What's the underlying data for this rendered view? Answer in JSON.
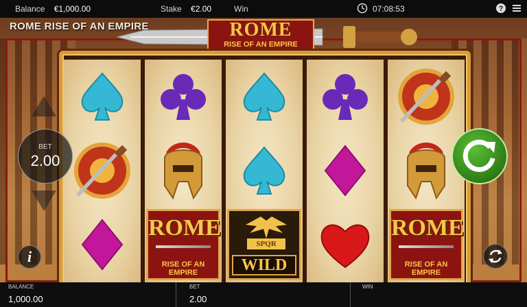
{
  "topbar": {
    "balance_label": "Balance",
    "balance_value": "€1,000.00",
    "stake_label": "Stake",
    "stake_value": "€2.00",
    "win_label": "Win",
    "time": "07:08:53"
  },
  "game": {
    "title": "ROME RISE OF AN EMPIRE",
    "logo_line1": "ROME",
    "logo_line2": "RISE OF AN EMPIRE"
  },
  "reels": [
    [
      "spade",
      "shield",
      "diamond"
    ],
    [
      "club",
      "helmet",
      "rome"
    ],
    [
      "spade",
      "spade",
      "wild"
    ],
    [
      "club",
      "diamond",
      "heart"
    ],
    [
      "shield",
      "helmet",
      "rome"
    ]
  ],
  "symbols": {
    "rome_line1": "ROME",
    "rome_line2": "RISE OF AN EMPIRE",
    "wild_badge": "SPQR",
    "wild_text": "WILD"
  },
  "controls": {
    "bet_label": "BET",
    "bet_value": "2.00",
    "info_label": "i"
  },
  "bottombar": {
    "balance_label": "BALANCE",
    "balance_value": "1,000.00",
    "bet_label": "BET",
    "bet_value": "2.00",
    "win_label": "WIN",
    "win_value": ""
  },
  "colors": {
    "accent_gold": "#e2a74a",
    "rome_red": "#8c1410",
    "spin_green": "#3a9a1c",
    "spade_cyan": "#35b8d4",
    "club_purple": "#6a2ab8",
    "diamond_magenta": "#c2179a",
    "heart_red": "#d81818"
  }
}
